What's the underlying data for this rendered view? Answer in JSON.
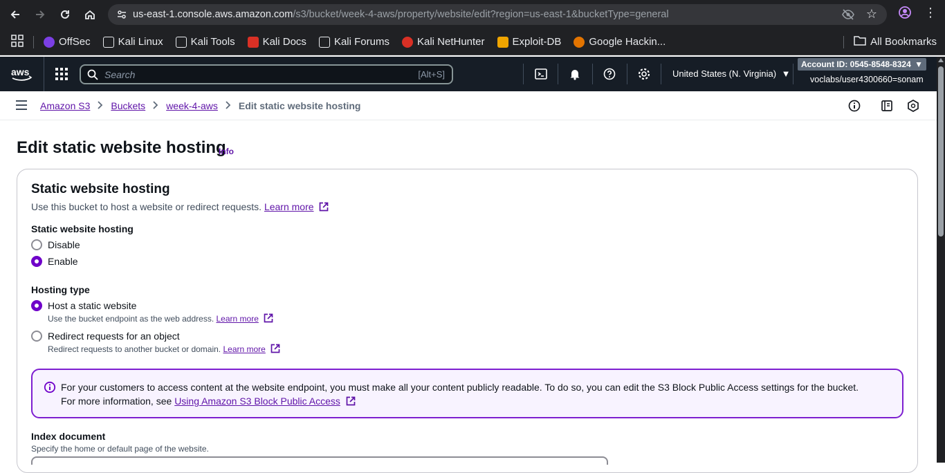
{
  "browser": {
    "url_domain": "us-east-1.console.aws.amazon.com",
    "url_path": "/s3/bucket/week-4-aws/property/website/edit?region=us-east-1&bucketType=general",
    "bookmarks": [
      "OffSec",
      "Kali Linux",
      "Kali Tools",
      "Kali Docs",
      "Kali Forums",
      "Kali NetHunter",
      "Exploit-DB",
      "Google Hackin..."
    ],
    "all_bookmarks": "All Bookmarks"
  },
  "aws_nav": {
    "search_placeholder": "Search",
    "search_shortcut": "[Alt+S]",
    "region": "United States (N. Virginia)",
    "account_id": "Account ID: 0545-8548-8324",
    "user": "voclabs/user4300660=sonam"
  },
  "breadcrumb": {
    "items": [
      "Amazon S3",
      "Buckets",
      "week-4-aws"
    ],
    "current": "Edit static website hosting"
  },
  "page": {
    "title": "Edit static website hosting",
    "info": "Info"
  },
  "panel": {
    "title": "Static website hosting",
    "desc": "Use this bucket to host a website or redirect requests.",
    "learn_more": "Learn more",
    "hosting_label": "Static website hosting",
    "disable": "Disable",
    "enable": "Enable",
    "hosting_type_label": "Hosting type",
    "host_static": "Host a static website",
    "host_static_desc": "Use the bucket endpoint as the web address.",
    "redirect": "Redirect requests for an object",
    "redirect_desc": "Redirect requests to another bucket or domain.",
    "alert_line1": "For your customers to access content at the website endpoint, you must make all your content publicly readable. To do so, you can edit the S3 Block Public Access settings for the bucket.",
    "alert_line2_prefix": "For more information, see",
    "alert_link": "Using Amazon S3 Block Public Access",
    "index_label": "Index document",
    "index_hint": "Specify the home or default page of the website."
  },
  "colors": {
    "accent": "#6f00c9",
    "link": "#5f13a8",
    "aws_nav_bg": "#161d26"
  }
}
